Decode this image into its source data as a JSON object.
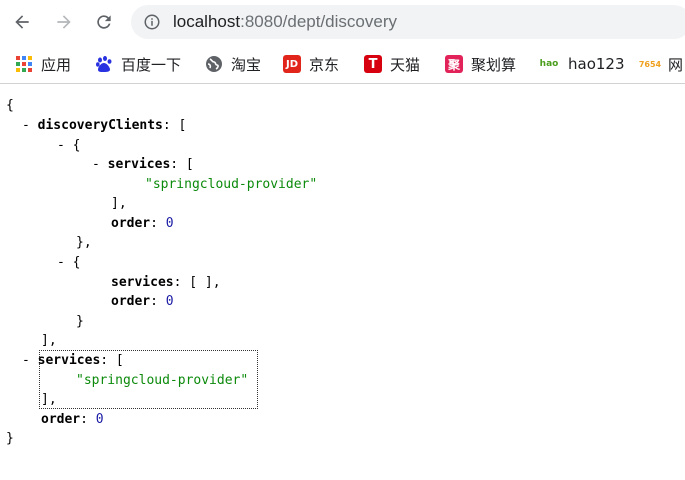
{
  "browser": {
    "url_host": "localhost",
    "url_rest": ":8080/dept/discovery",
    "nav_icons": [
      "back-arrow-icon",
      "forward-arrow-icon",
      "reload-icon",
      "site-info-icon"
    ]
  },
  "bookmarks": [
    {
      "label": "应用",
      "icon": "apps-grid-icon"
    },
    {
      "label": "百度一下",
      "icon": "baidu-paw-icon"
    },
    {
      "label": "淘宝",
      "icon": "globe-icon"
    },
    {
      "label": "京东",
      "icon": "jd-icon",
      "icon_text": "JD"
    },
    {
      "label": "天猫",
      "icon": "tmall-icon",
      "icon_text": "T"
    },
    {
      "label": "聚划算",
      "icon": "juhuasuan-icon",
      "icon_text": "聚"
    },
    {
      "label": "hao123",
      "icon": "hao123-icon",
      "icon_text": "hao"
    },
    {
      "label": "网",
      "icon": "7654-icon",
      "icon_text": "7654"
    }
  ],
  "json": {
    "open_brace": "{",
    "close_brace": "}",
    "collapse_marker": "-",
    "key_discoveryClients": "discoveryClients",
    "key_services": "services",
    "key_order": "order",
    "string_provider": "\"springcloud-provider\"",
    "number_order": "0",
    "empty_array": "[ ]"
  },
  "colors": {
    "string": "#0b8a0b",
    "number": "#1a1aa6",
    "omnibox": "#f1f3f4"
  }
}
